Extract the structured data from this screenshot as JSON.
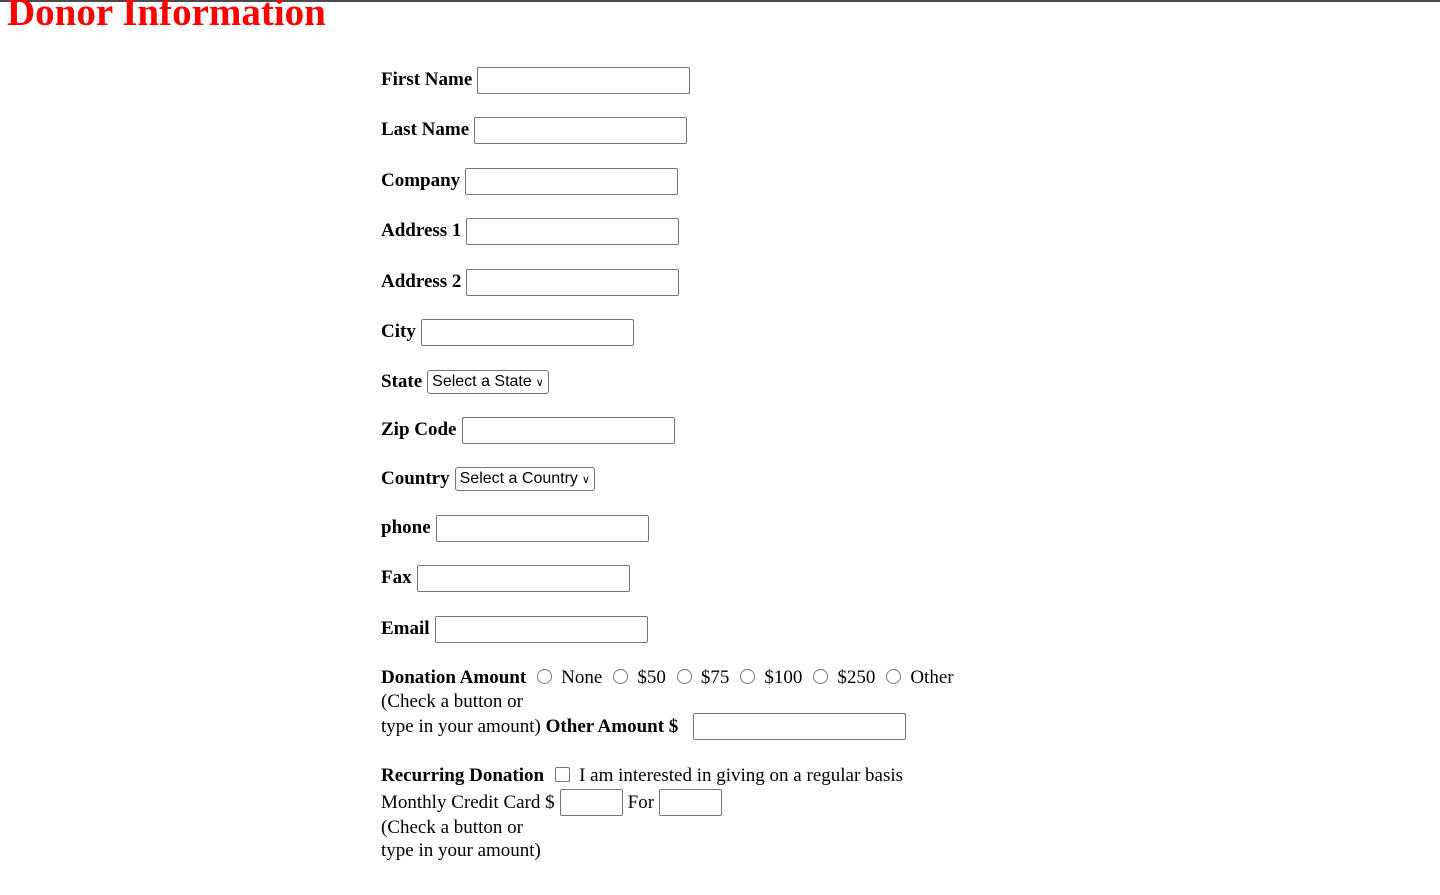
{
  "title": "Donor Information",
  "fields": [
    {
      "label": "First Name",
      "type": "text"
    },
    {
      "label": "Last Name",
      "type": "text"
    },
    {
      "label": "Company",
      "type": "text"
    },
    {
      "label": "Address 1",
      "type": "text"
    },
    {
      "label": "Address 2",
      "type": "text"
    },
    {
      "label": "City",
      "type": "text"
    },
    {
      "label": "State",
      "type": "select",
      "value": "Select a State"
    },
    {
      "label": "Zip Code",
      "type": "text"
    },
    {
      "label": "Country",
      "type": "select",
      "value": "Select a Country"
    },
    {
      "label": "phone",
      "type": "text"
    },
    {
      "label": "Fax",
      "type": "text"
    },
    {
      "label": "Email",
      "type": "text"
    }
  ],
  "donation": {
    "label": "Donation Amount",
    "options": [
      "None",
      "$50",
      "$75",
      "$100",
      "$250",
      "Other"
    ],
    "hint1": "(Check a button or",
    "hint2": "type in your amount)",
    "other_label": "Other Amount $"
  },
  "recurring": {
    "label": "Recurring Donation",
    "checkbox_label": "I am interested in giving on a regular basis",
    "monthly_label": "Monthly Credit Card $",
    "for_label": "For",
    "hint1": "(Check a button or",
    "hint2": "type in your amount)"
  }
}
